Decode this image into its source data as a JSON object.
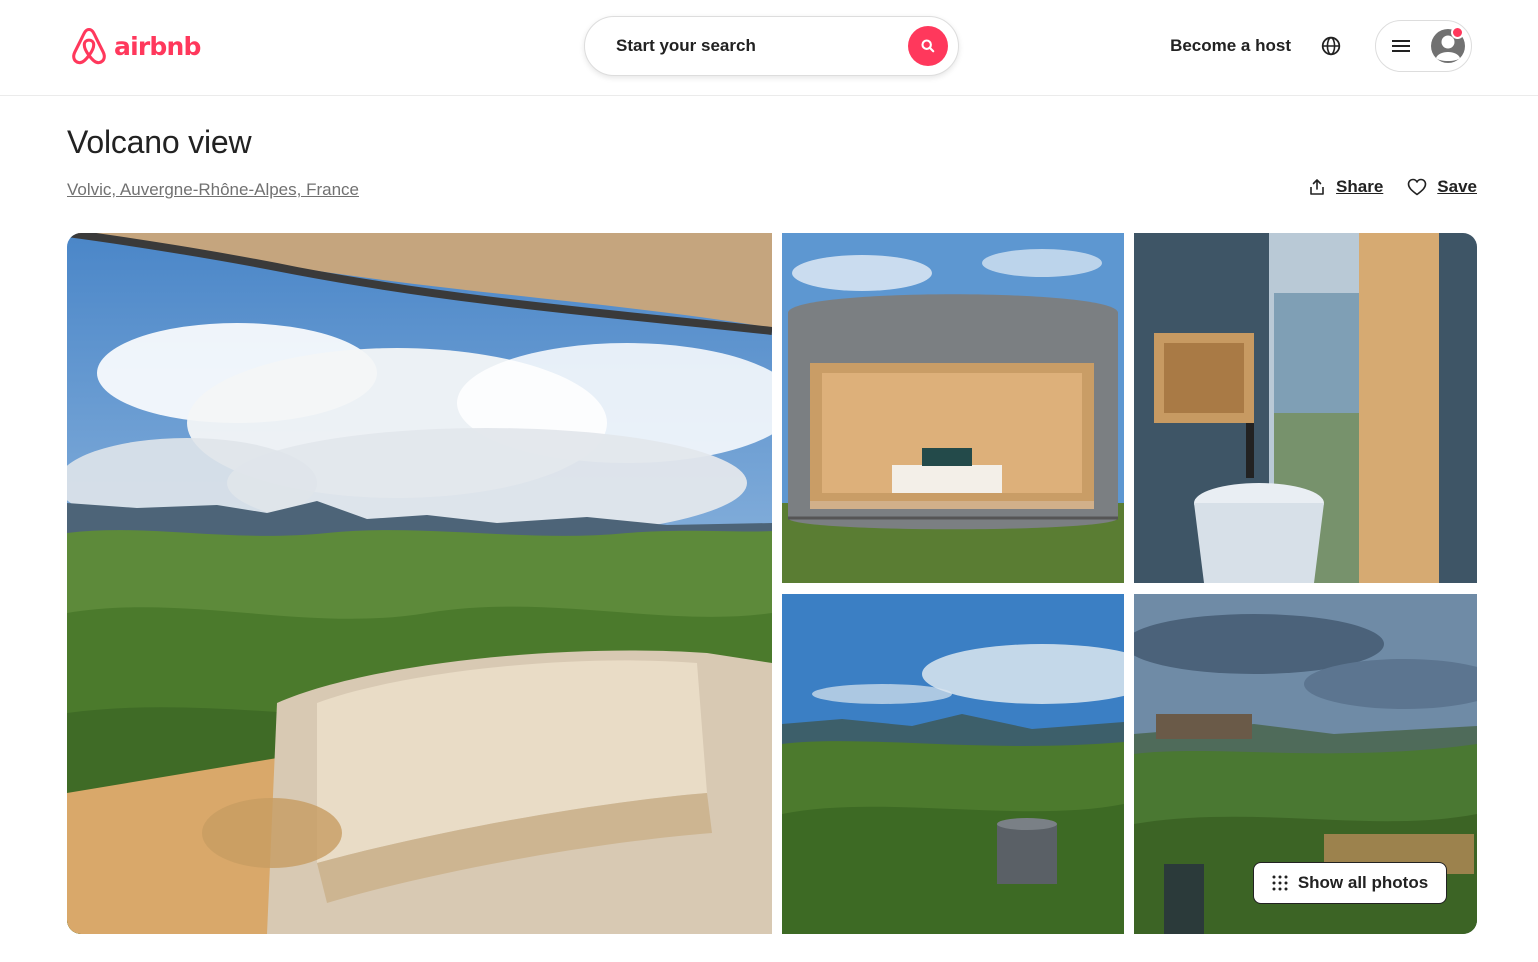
{
  "header": {
    "brand": "airbnb",
    "search_placeholder": "Start your search",
    "become_host": "Become a host"
  },
  "listing": {
    "title": "Volcano view",
    "location": "Volvic, Auvergne-Rhône-Alpes, France",
    "share_label": "Share",
    "save_label": "Save"
  },
  "gallery": {
    "show_all_label": "Show all photos"
  },
  "colors": {
    "brand": "#FF385C",
    "text": "#222222",
    "muted": "#717171"
  },
  "icons": [
    "airbnb-logo-icon",
    "search-icon",
    "globe-icon",
    "menu-icon",
    "avatar-icon",
    "share-icon",
    "heart-icon",
    "grid-dots-icon"
  ]
}
